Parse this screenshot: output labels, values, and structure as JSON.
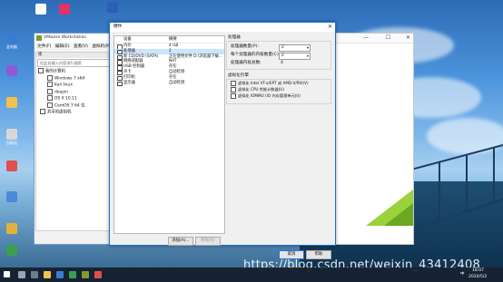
{
  "desktop": {
    "icons": [
      {
        "label": "此电脑",
        "color": "#3a7bd5"
      },
      {
        "label": "",
        "color": "#8e5bd6"
      },
      {
        "label": "",
        "color": "#f2c14e"
      },
      {
        "label": "回收站",
        "color": "#d8d8d8"
      },
      {
        "label": "",
        "color": "#e04f4f"
      },
      {
        "label": "",
        "color": "#4a8ad8"
      },
      {
        "label": "",
        "color": "#e2b23a"
      },
      {
        "label": "",
        "color": "#3b9e52"
      },
      {
        "label": "",
        "color": "#f0c45a"
      },
      {
        "label": "",
        "color": "#6fb3e6"
      },
      {
        "label": "",
        "color": "#e35d5d"
      },
      {
        "label": "",
        "color": "#3a7bd5"
      }
    ],
    "top_icons": [
      {
        "label": "",
        "color": "#ffffff"
      },
      {
        "label": "",
        "color": "#e5306a"
      },
      {
        "label": "",
        "color": "#2b5fb8"
      }
    ],
    "watermark": "https://blog.csdn.net/weixin_43412408"
  },
  "vmware": {
    "title": "VMware Workstation",
    "menu": [
      "文件(F)",
      "编辑(E)",
      "查看(V)",
      "虚拟机(M)"
    ],
    "library_label": "库",
    "search_placeholder": "在此处键入内容进行搜索",
    "tree_root": "我的计算机",
    "vms": [
      "Windows 7 x64",
      "Kali linux",
      "deepin",
      "OS X 10.11",
      "CentOS 7 64 位"
    ],
    "shared": "共享的虚拟机"
  },
  "dialog": {
    "title": "硬件",
    "col_device": "设备",
    "col_summary": "摘要",
    "devices": [
      {
        "name": "内存",
        "summary": "4 GB",
        "icon": "memory-icon"
      },
      {
        "name": "处理器",
        "summary": "2",
        "icon": "cpu-icon"
      },
      {
        "name": "新 CD/DVD (SATA)",
        "summary": "正在使用文件 D:\\浏览器下载...",
        "icon": "cd-icon"
      },
      {
        "name": "网络适配器",
        "summary": "NAT",
        "icon": "network-icon"
      },
      {
        "name": "USB 控制器",
        "summary": "存在",
        "icon": "usb-icon"
      },
      {
        "name": "声卡",
        "summary": "自动检测",
        "icon": "sound-icon"
      },
      {
        "name": "打印机",
        "summary": "存在",
        "icon": "printer-icon"
      },
      {
        "name": "显示器",
        "summary": "自动检测",
        "icon": "display-icon"
      }
    ],
    "add_button": "添加(A)...",
    "remove_button": "移除(R)",
    "processor_group": {
      "title": "处理器",
      "count_label": "处理器数量(P):",
      "count_value": "2",
      "cores_label": "每个处理器的内核数量(C):",
      "cores_value": "2",
      "total_label": "处理器内核总数:",
      "total_value": "4"
    },
    "virt_group": {
      "title": "虚拟化引擎",
      "options": [
        "虚拟化 Intel VT-x/EPT 或 AMD-V/RVI(V)",
        "虚拟化 CPU 性能计数器(U)",
        "虚拟化 IOMMU (IO 内存管理单元)(I)"
      ]
    },
    "ok_button": "确定",
    "cancel_button": "取消",
    "help_button": "帮助"
  },
  "taskbar": {
    "search_text": "",
    "time": "18:07",
    "date": "2020/5/2",
    "lang": "中"
  }
}
